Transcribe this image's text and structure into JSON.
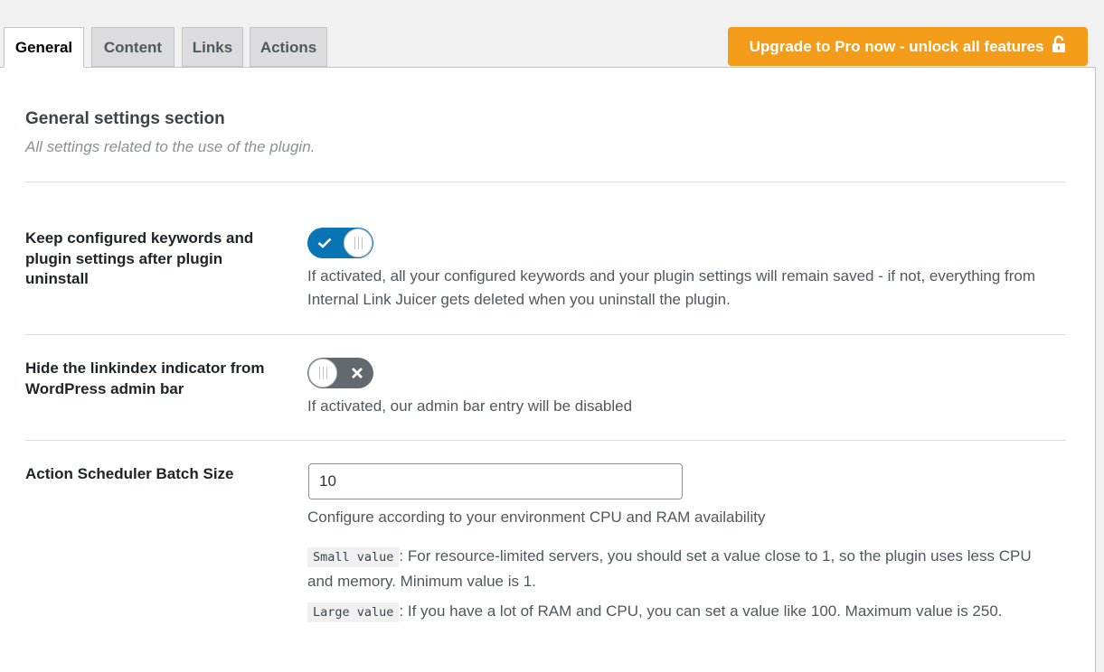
{
  "tabs": [
    {
      "label": "General",
      "active": true
    },
    {
      "label": "Content",
      "active": false
    },
    {
      "label": "Links",
      "active": false
    },
    {
      "label": "Actions",
      "active": false
    }
  ],
  "upgrade_button": {
    "label": "Upgrade to Pro now - unlock all features",
    "icon": "lock-icon",
    "color": "#f39c1a"
  },
  "section": {
    "title": "General settings section",
    "description": "All settings related to the use of the plugin."
  },
  "settings": {
    "keep_config": {
      "label": "Keep configured keywords and plugin settings after plugin uninstall",
      "enabled": true,
      "description": "If activated, all your configured keywords and your plugin settings will remain saved - if not, everything from Internal Link Juicer gets deleted when you uninstall the plugin."
    },
    "hide_indicator": {
      "label": "Hide the linkindex indicator from WordPress admin bar",
      "enabled": false,
      "description": "If activated, our admin bar entry will be disabled"
    },
    "batch_size": {
      "label": "Action Scheduler Batch Size",
      "value": "10",
      "description": "Configure according to your environment CPU and RAM availability",
      "notes": [
        {
          "code": "Small value",
          "text": ": For resource-limited servers, you should set a value close to 1, so the plugin uses less CPU and memory. Minimum value is 1."
        },
        {
          "code": "Large value",
          "text": ": If you have a lot of RAM and CPU, you can set a value like 100. Maximum value is 250."
        }
      ]
    }
  },
  "colors": {
    "toggle_on": "#0a75b5",
    "toggle_off": "#646970",
    "accent": "#f39c1a"
  }
}
